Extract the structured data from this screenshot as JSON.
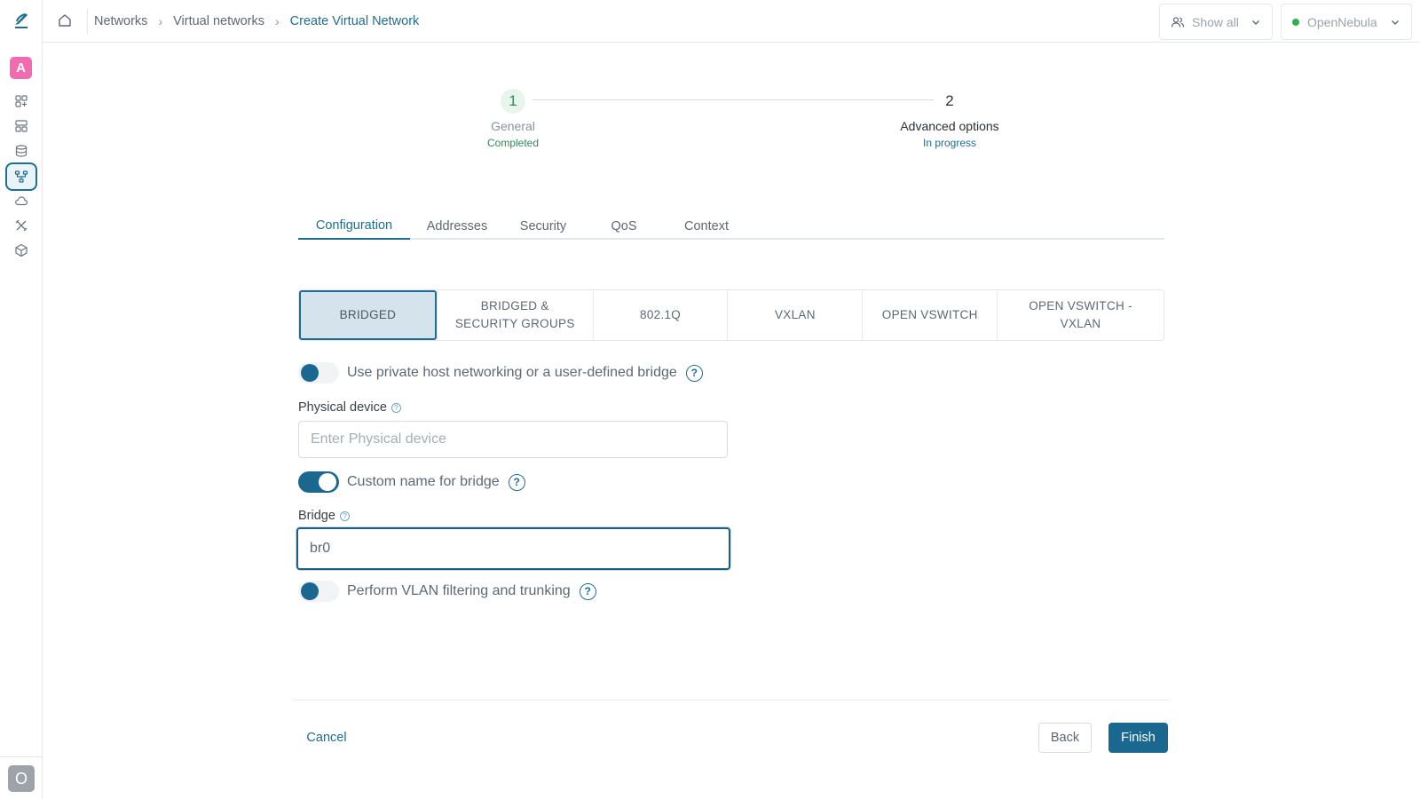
{
  "breadcrumb": {
    "items": [
      "Networks",
      "Virtual networks"
    ],
    "current": "Create Virtual Network"
  },
  "header": {
    "show_all_label": "Show all",
    "zone_label": "OpenNebula",
    "zone_status_color": "#2eb24d"
  },
  "sidebar": {
    "avatar_top": "A",
    "avatar_bottom": "O",
    "icons": [
      "dashboard-icon",
      "instances-icon",
      "storage-icon",
      "networks-icon",
      "cloud-icon",
      "tools-icon",
      "infrastructure-icon"
    ],
    "active_icon": "networks-icon"
  },
  "stepper": {
    "steps": [
      {
        "number": "1",
        "title": "General",
        "status": "Completed"
      },
      {
        "number": "2",
        "title": "Advanced options",
        "status": "In progress"
      }
    ]
  },
  "tabs": [
    "Configuration",
    "Addresses",
    "Security",
    "QoS",
    "Context"
  ],
  "active_tab": "Configuration",
  "drivers": {
    "options": [
      "BRIDGED",
      "BRIDGED & SECURITY GROUPS",
      "802.1Q",
      "VXLAN",
      "OPEN VSWITCH",
      "OPEN VSWITCH - VXLAN"
    ],
    "selected": "BRIDGED"
  },
  "form": {
    "private_host_toggle": {
      "label": "Use private host networking or a user-defined bridge",
      "checked": false
    },
    "physical_device": {
      "label": "Physical device",
      "value": "",
      "placeholder": "Enter Physical device"
    },
    "custom_bridge_toggle": {
      "label": "Custom name for bridge",
      "checked": true
    },
    "bridge": {
      "label": "Bridge",
      "value": "br0"
    },
    "vlan_toggle": {
      "label": "Perform VLAN filtering and trunking",
      "checked": false
    }
  },
  "footer": {
    "cancel_label": "Cancel",
    "back_label": "Back",
    "finish_label": "Finish"
  },
  "colors": {
    "accent": "#1f6d92",
    "primary_button": "#1a6890",
    "completed": "#2e8b57",
    "avatar_top": "#f06bb0"
  }
}
